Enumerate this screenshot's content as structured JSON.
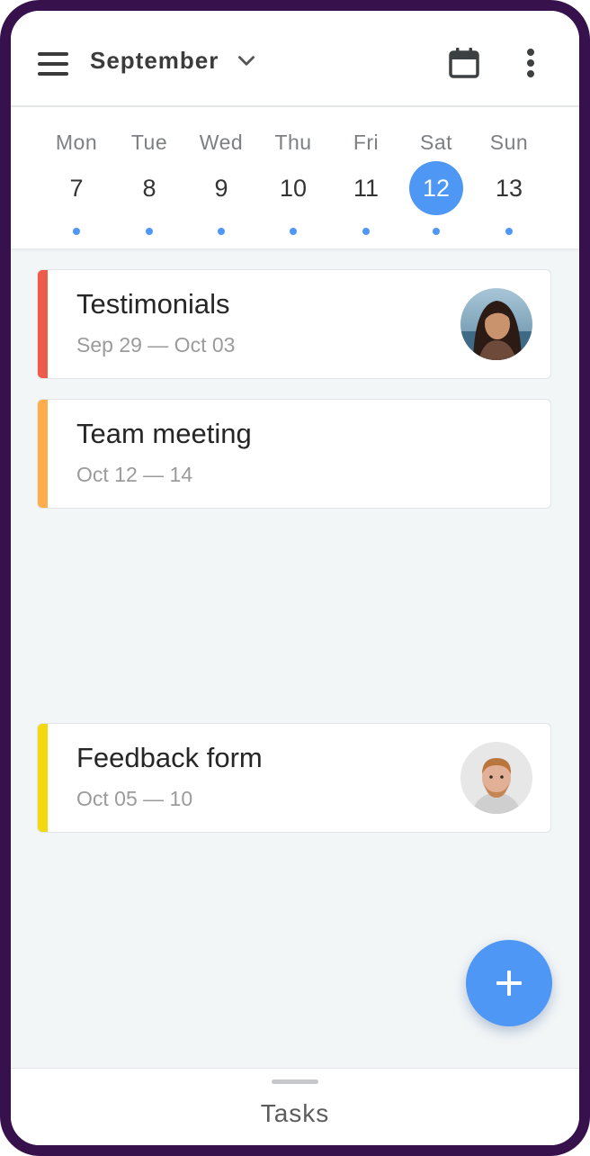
{
  "header": {
    "month": "September"
  },
  "week": [
    {
      "name": "Mon",
      "num": "7",
      "selected": false
    },
    {
      "name": "Tue",
      "num": "8",
      "selected": false
    },
    {
      "name": "Wed",
      "num": "9",
      "selected": false
    },
    {
      "name": "Thu",
      "num": "10",
      "selected": false
    },
    {
      "name": "Fri",
      "num": "11",
      "selected": false
    },
    {
      "name": "Sat",
      "num": "12",
      "selected": true
    },
    {
      "name": "Sun",
      "num": "13",
      "selected": false
    }
  ],
  "tasks": [
    {
      "title": "Testimonials",
      "dates": "Sep 29 — Oct 03",
      "color": "#ef5b4b",
      "avatar": "woman-avatar"
    },
    {
      "title": "Team meeting",
      "dates": "Oct 12 — 14",
      "color": "#ffac4a",
      "avatar": null
    },
    {
      "title": "Feedback form",
      "dates": "Oct 05 — 10",
      "color": "#f4d910",
      "avatar": "man-avatar"
    }
  ],
  "bottom": {
    "label": "Tasks"
  },
  "colors": {
    "accent": "#4e97f5",
    "frame": "#37114c"
  },
  "icons": [
    "menu-icon",
    "chevron-down-icon",
    "calendar-icon",
    "more-vertical-icon",
    "plus-icon"
  ]
}
